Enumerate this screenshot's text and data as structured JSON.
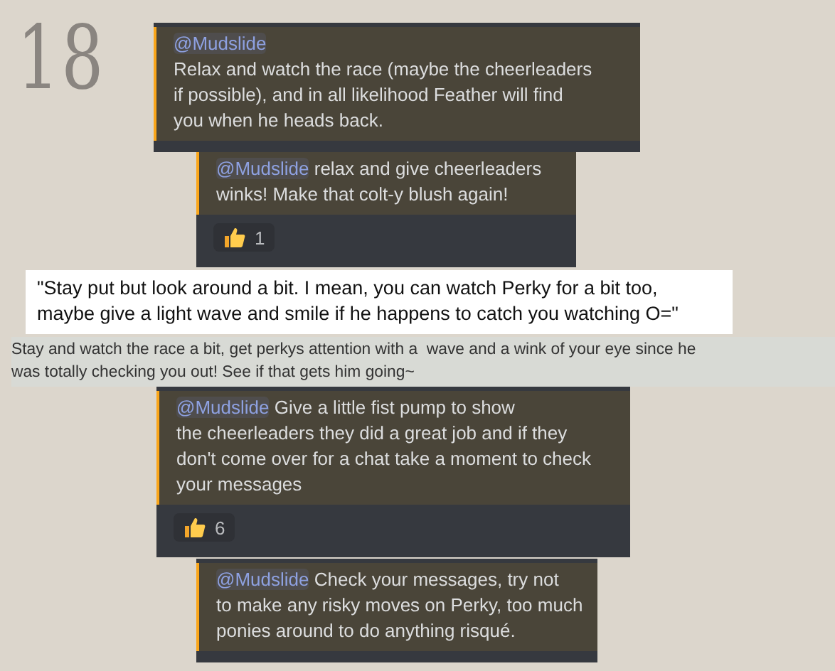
{
  "page_number": "18",
  "blocks": [
    {
      "kind": "chat",
      "mention": "@Mudslide",
      "mention_break": true,
      "lines": [
        "Relax and watch the race (maybe the cheerleaders",
        "if possible), and in all likelihood Feather will find",
        "you when he heads back."
      ]
    },
    {
      "kind": "chat",
      "mention": "@Mudslide",
      "mention_break": false,
      "lines": [
        "relax and give cheerleaders",
        "winks! Make that colt-y blush again!"
      ],
      "reaction": {
        "count": "1"
      }
    },
    {
      "kind": "quote",
      "lines": [
        "\"Stay put but look around a bit. I mean, you can watch Perky for a bit too,",
        "maybe give a light wave and smile if he happens to catch you watching O=\""
      ]
    },
    {
      "kind": "note",
      "lines": [
        "Stay and watch the race a bit, get perkys attention with a  wave and a wink of your eye since he",
        "was totally checking you out! See if that gets him going~"
      ]
    },
    {
      "kind": "chat",
      "mention": "@Mudslide",
      "mention_break": false,
      "lines": [
        "Give a little fist pump to show",
        "the cheerleaders they did a great job and if they",
        "don't come over for a chat take a moment to check",
        "your messages"
      ],
      "reaction": {
        "count": "6"
      }
    },
    {
      "kind": "chat",
      "mention": "@Mudslide",
      "mention_break": false,
      "lines": [
        "Check your messages, try not",
        "to make any risky moves on Perky, too much",
        "ponies around to do anything risqué."
      ]
    }
  ]
}
